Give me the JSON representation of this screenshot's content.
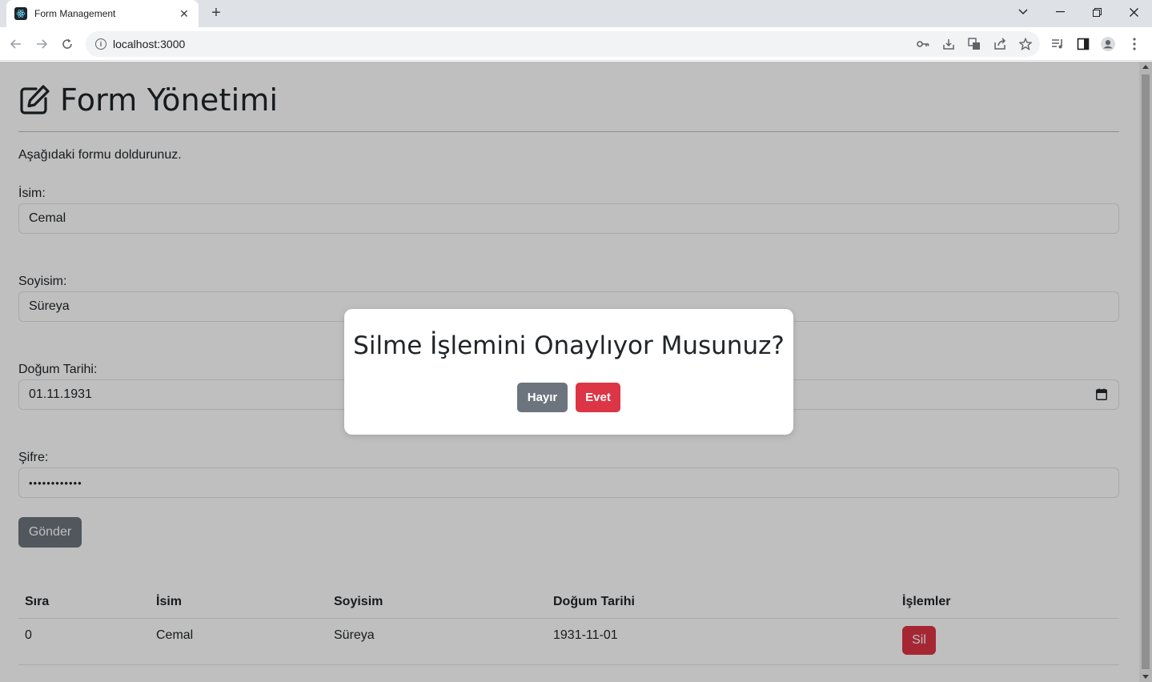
{
  "browser": {
    "tab_title": "Form Management",
    "url": "localhost:3000"
  },
  "page": {
    "title": "Form Yönetimi",
    "lead": "Aşağıdaki formu doldurunuz.",
    "form": {
      "name_label": "İsim:",
      "name_value": "Cemal",
      "surname_label": "Soyisim:",
      "surname_value": "Süreya",
      "birthdate_label": "Doğum Tarihi:",
      "birthdate_value": "01.11.1931",
      "password_label": "Şifre:",
      "password_value": "••••••••••••",
      "submit_label": "Gönder"
    },
    "table": {
      "headers": [
        "Sıra",
        "İsim",
        "Soyisim",
        "Doğum Tarihi",
        "İşlemler"
      ],
      "rows": [
        {
          "index": "0",
          "name": "Cemal",
          "surname": "Süreya",
          "birthdate": "1931-11-01",
          "action": "Sil"
        }
      ]
    }
  },
  "modal": {
    "question": "Silme İşlemini Onaylıyor Musunuz?",
    "no_label": "Hayır",
    "yes_label": "Evet"
  },
  "colors": {
    "secondary": "#6c757d",
    "danger": "#dc3545"
  }
}
